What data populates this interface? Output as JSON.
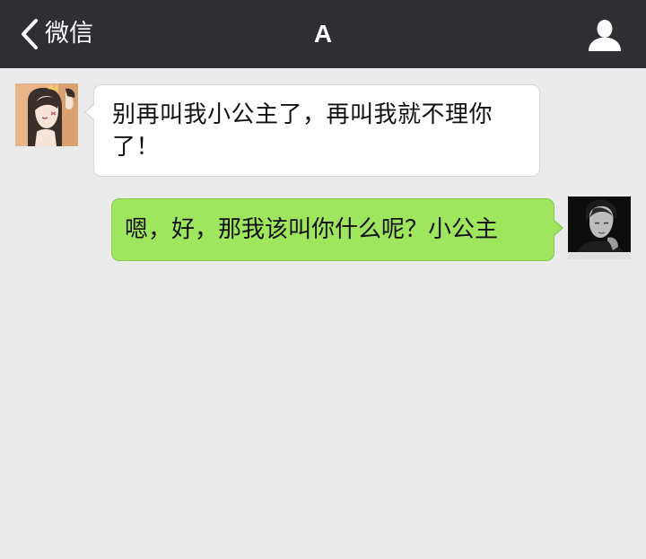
{
  "navbar": {
    "back_label": "微信",
    "back_icon": "chevron-left-icon",
    "title": "A",
    "profile_icon": "person-icon"
  },
  "messages": [
    {
      "side": "left",
      "avatar": "cartoon-girl-avatar",
      "text": "别再叫我小公主了，再叫我就不理你了！"
    },
    {
      "side": "right",
      "avatar": "man-photo-avatar",
      "text": "嗯，好，那我该叫你什么呢？小公主"
    }
  ],
  "colors": {
    "navbar_bg": "#2e2e33",
    "chat_bg": "#ebebeb",
    "incoming_bubble": "#ffffff",
    "outgoing_bubble": "#9fe65e"
  }
}
